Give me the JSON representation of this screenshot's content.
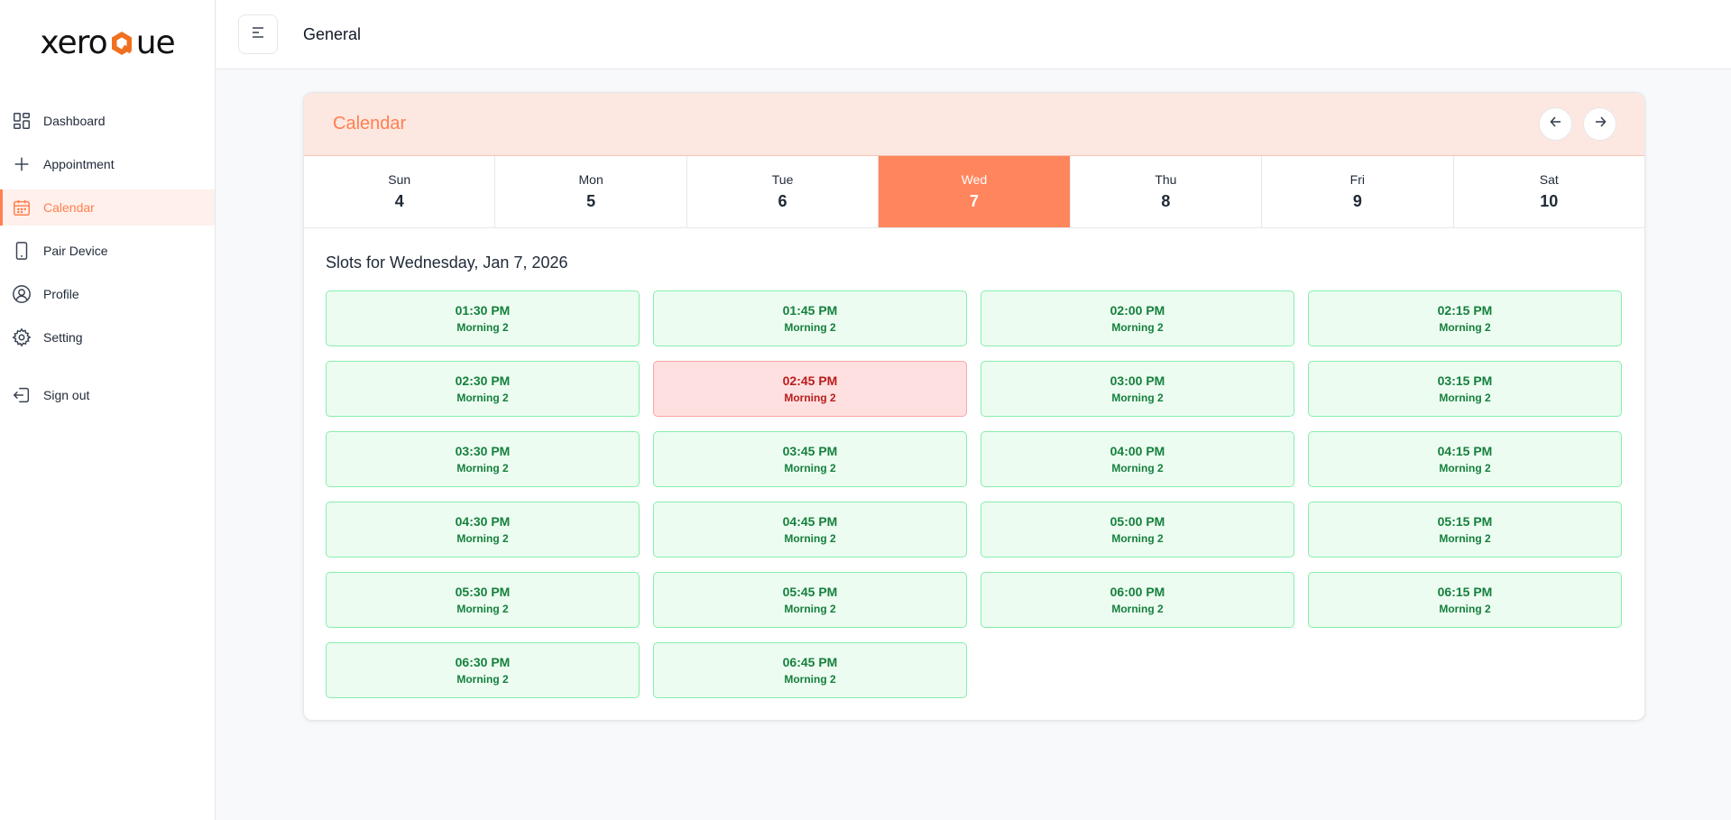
{
  "app": {
    "logo_left": "xero",
    "logo_right": "ue"
  },
  "sidebar": {
    "items": [
      {
        "label": "Dashboard",
        "icon": "dashboard-icon"
      },
      {
        "label": "Appointment",
        "icon": "plus-icon"
      },
      {
        "label": "Calendar",
        "icon": "calendar-icon",
        "active": true
      },
      {
        "label": "Pair Device",
        "icon": "tablet-icon"
      },
      {
        "label": "Profile",
        "icon": "user-circle-icon"
      },
      {
        "label": "Setting",
        "icon": "gear-icon"
      }
    ],
    "signout": {
      "label": "Sign out",
      "icon": "sign-out-icon"
    }
  },
  "header": {
    "title": "General",
    "menu_icon": "menu-icon"
  },
  "calendar": {
    "title": "Calendar",
    "prev_icon": "arrow-left-icon",
    "next_icon": "arrow-right-icon",
    "days": [
      {
        "name": "Sun",
        "num": "4"
      },
      {
        "name": "Mon",
        "num": "5"
      },
      {
        "name": "Tue",
        "num": "6"
      },
      {
        "name": "Wed",
        "num": "7",
        "active": true
      },
      {
        "name": "Thu",
        "num": "8"
      },
      {
        "name": "Fri",
        "num": "9"
      },
      {
        "name": "Sat",
        "num": "10"
      }
    ],
    "slots_title": "Slots for Wednesday, Jan 7, 2026",
    "slots": [
      {
        "time": "01:30 PM",
        "label": "Morning 2",
        "status": "available"
      },
      {
        "time": "01:45 PM",
        "label": "Morning 2",
        "status": "available"
      },
      {
        "time": "02:00 PM",
        "label": "Morning 2",
        "status": "available"
      },
      {
        "time": "02:15 PM",
        "label": "Morning 2",
        "status": "available"
      },
      {
        "time": "02:30 PM",
        "label": "Morning 2",
        "status": "available"
      },
      {
        "time": "02:45 PM",
        "label": "Morning 2",
        "status": "booked"
      },
      {
        "time": "03:00 PM",
        "label": "Morning 2",
        "status": "available"
      },
      {
        "time": "03:15 PM",
        "label": "Morning 2",
        "status": "available"
      },
      {
        "time": "03:30 PM",
        "label": "Morning 2",
        "status": "available"
      },
      {
        "time": "03:45 PM",
        "label": "Morning 2",
        "status": "available"
      },
      {
        "time": "04:00 PM",
        "label": "Morning 2",
        "status": "available"
      },
      {
        "time": "04:15 PM",
        "label": "Morning 2",
        "status": "available"
      },
      {
        "time": "04:30 PM",
        "label": "Morning 2",
        "status": "available"
      },
      {
        "time": "04:45 PM",
        "label": "Morning 2",
        "status": "available"
      },
      {
        "time": "05:00 PM",
        "label": "Morning 2",
        "status": "available"
      },
      {
        "time": "05:15 PM",
        "label": "Morning 2",
        "status": "available"
      },
      {
        "time": "05:30 PM",
        "label": "Morning 2",
        "status": "available"
      },
      {
        "time": "05:45 PM",
        "label": "Morning 2",
        "status": "available"
      },
      {
        "time": "06:00 PM",
        "label": "Morning 2",
        "status": "available"
      },
      {
        "time": "06:15 PM",
        "label": "Morning 2",
        "status": "available"
      },
      {
        "time": "06:30 PM",
        "label": "Morning 2",
        "status": "available"
      },
      {
        "time": "06:45 PM",
        "label": "Morning 2",
        "status": "available"
      }
    ]
  },
  "colors": {
    "accent": "#ff7f50",
    "accent_active_day": "#ff855c",
    "header_bg": "#fde8e1",
    "available_bg": "#edfcf1",
    "available_text": "#15803d",
    "booked_bg": "#ffe0e0",
    "booked_text": "#b91c1c"
  }
}
